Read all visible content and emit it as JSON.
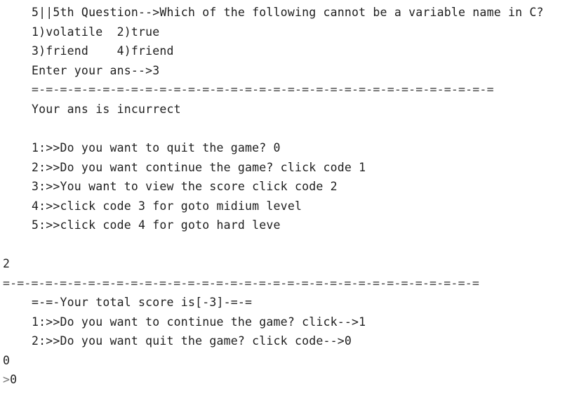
{
  "console": {
    "lines": {
      "q_header": "5||5th Question-->Which of the following cannot be a variable name in C?",
      "opts_row1": "1)volatile  2)true",
      "opts_row2": "3)friend    4)friend",
      "enter_ans": "Enter your ans-->3",
      "sep1": "=-=-=-=-=-=-=-=-=-=-=-=-=-=-=-=-=-=-=-=-=-=-=-=-=-=-=-=-=-=-=-=-=",
      "result": "Your ans is incurrect",
      "menu1": "1:>>Do you want to quit the game? 0",
      "menu2": "2:>>Do you want continue the game? click code 1",
      "menu3": "3:>>You want to view the score click code 2",
      "menu4": "4:>>click code 3 for goto midium level",
      "menu5": "5:>>click code 4 for goto hard leve",
      "input_2": "2",
      "sep2": "=-=-=-=-=-=-=-=-=-=-=-=-=-=-=-=-=-=-=-=-=-=-=-=-=-=-=-=-=-=-=-=-=-=",
      "score": "=-=-Your total score is[-3]-=-=",
      "cont1": "1:>>Do you want to continue the game? click-->1",
      "cont2": "2:>>Do you want quit the game? click code-->0",
      "input_0": "0",
      "prompt_symbol": ">",
      "prompt_value": "0"
    }
  }
}
